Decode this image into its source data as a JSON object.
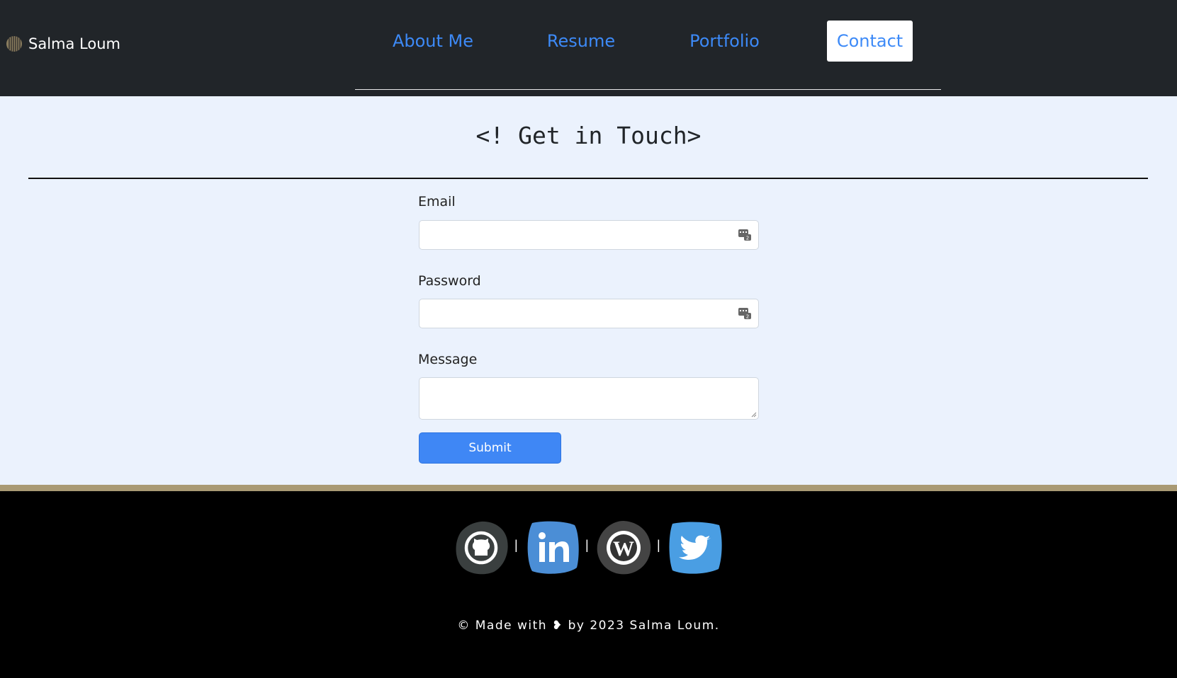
{
  "header": {
    "brand_name": "Salma Loum",
    "nav": [
      {
        "label": "About Me"
      },
      {
        "label": "Resume"
      },
      {
        "label": "Portfolio"
      },
      {
        "label": "Contact",
        "active": true
      }
    ]
  },
  "main": {
    "title": "<! Get in Touch>",
    "form": {
      "email_label": "Email",
      "email_value": "",
      "password_label": "Password",
      "password_value": "",
      "message_label": "Message",
      "message_value": "",
      "submit_label": "Submit"
    }
  },
  "footer": {
    "social": [
      {
        "name": "github-icon"
      },
      {
        "name": "linkedin-icon"
      },
      {
        "name": "wordpress-icon"
      },
      {
        "name": "twitter-icon"
      }
    ],
    "separator": "|",
    "copyright": "© Made with ❥ by 2023 Salma Loum."
  },
  "colors": {
    "nav_text": "#3d8af7",
    "header_bg": "#212529",
    "main_bg": "#ebf2fd",
    "submit_bg": "#3f87f5",
    "footer_stripe": "#a99a74"
  }
}
